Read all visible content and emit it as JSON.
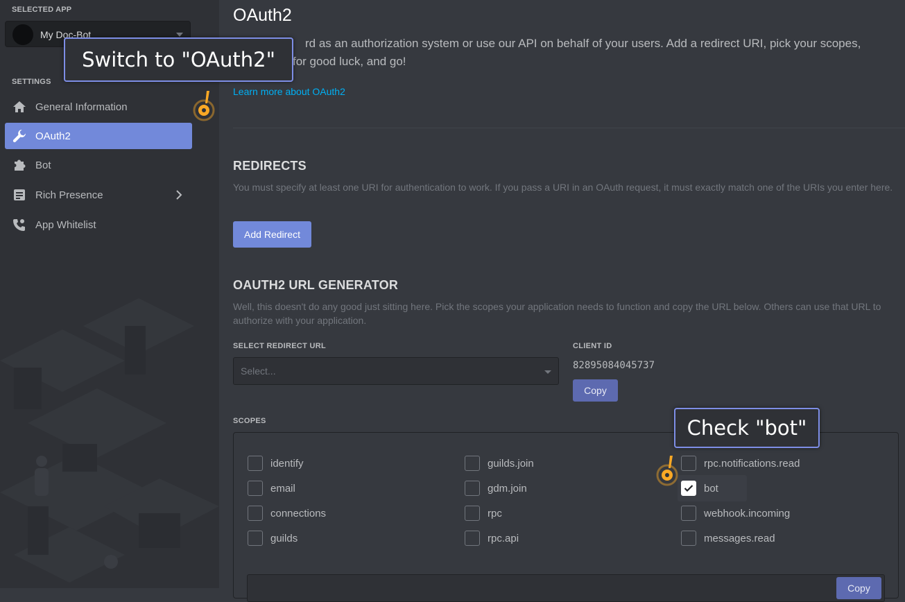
{
  "sidebar": {
    "selected_app_label": "SELECTED APP",
    "app_name": "My Doc-Bot",
    "settings_label": "SETTINGS",
    "items": [
      {
        "label": "General Information",
        "icon": "home-icon"
      },
      {
        "label": "OAuth2",
        "icon": "wrench-icon",
        "active": true
      },
      {
        "label": "Bot",
        "icon": "puzzle-icon"
      },
      {
        "label": "Rich Presence",
        "icon": "document-icon",
        "has_submenu": true
      },
      {
        "label": "App Whitelist",
        "icon": "person-phone-icon"
      }
    ]
  },
  "main": {
    "title": "OAuth2",
    "description": "...ord as an authorization system or use our API on behalf of your users. Add a redirect URI, pick your scopes, ... for good luck, and go!",
    "description_line1": "rd as an authorization system or use our API on behalf of your users. Add a redirect URI, pick your scopes,",
    "description_line2": "for good luck, and go!",
    "learn_more": "Learn more about OAuth2",
    "redirects": {
      "title": "REDIRECTS",
      "description": "You must specify at least one URI for authentication to work. If you pass a URI in an OAuth request, it must exactly match one of the URIs you enter here.",
      "add_button": "Add Redirect"
    },
    "generator": {
      "title": "OAUTH2 URL GENERATOR",
      "description": "Well, this doesn't do any good just sitting here. Pick the scopes your application needs to function and copy the URL below. Others can use that URL to authorize with your application.",
      "redirect_label": "SELECT REDIRECT URL",
      "redirect_placeholder": "Select...",
      "client_id_label": "CLIENT ID",
      "client_id": "82895084045737",
      "copy_label": "Copy",
      "scopes_label": "SCOPES",
      "scopes": [
        [
          {
            "name": "identify",
            "checked": false
          },
          {
            "name": "email",
            "checked": false
          },
          {
            "name": "connections",
            "checked": false
          },
          {
            "name": "guilds",
            "checked": false
          }
        ],
        [
          {
            "name": "guilds.join",
            "checked": false
          },
          {
            "name": "gdm.join",
            "checked": false
          },
          {
            "name": "rpc",
            "checked": false
          },
          {
            "name": "rpc.api",
            "checked": false
          }
        ],
        [
          {
            "name": "rpc.notifications.read",
            "checked": false
          },
          {
            "name": "bot",
            "checked": true
          },
          {
            "name": "webhook.incoming",
            "checked": false
          },
          {
            "name": "messages.read",
            "checked": false
          }
        ]
      ],
      "url_copy_label": "Copy"
    }
  },
  "callouts": {
    "switch": "Switch to \"OAuth2\"",
    "check": "Check \"bot\""
  },
  "colors": {
    "accent": "#7289da",
    "callout_border": "#7e8ee6",
    "hint": "#f9a825",
    "link": "#00b0f4"
  }
}
